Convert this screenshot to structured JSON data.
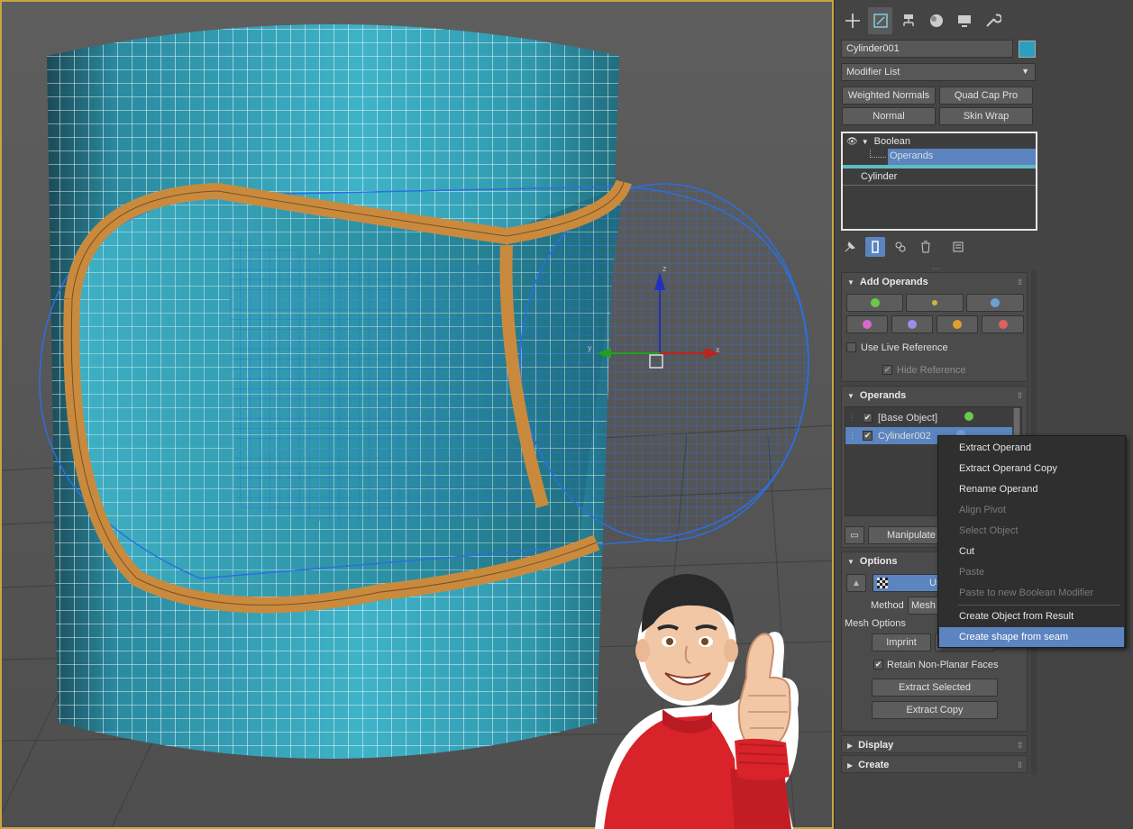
{
  "panel": {
    "tabs": [
      "create-icon",
      "modify-icon",
      "hierarchy-icon",
      "motion-icon",
      "display-icon",
      "utilities-icon"
    ],
    "object_name": "Cylinder001",
    "object_color": "#2a9fc0",
    "modifier_list": "Modifier List",
    "quick_buttons": [
      "Weighted Normals",
      "Quad Cap Pro",
      "Normal",
      "Skin Wrap"
    ],
    "stack": {
      "boolean": "Boolean",
      "operands": "Operands",
      "cylinder": "Cylinder"
    }
  },
  "add_operands": {
    "title": "Add Operands",
    "use_live_reference": "Use Live Reference",
    "hide_reference": "Hide Reference"
  },
  "operands": {
    "title": "Operands",
    "items": [
      "[Base Object]",
      "Cylinder002"
    ],
    "manipulate": "Manipulate"
  },
  "options": {
    "title": "Options",
    "use_label": "Use",
    "method_label": "Method",
    "method_value": "Mesh",
    "mesh_options": "Mesh Options",
    "imprint": "Imprint",
    "retain": "Retain Non-Planar Faces",
    "extract_selected": "Extract Selected",
    "extract_copy": "Extract Copy"
  },
  "display": {
    "title": "Display"
  },
  "create": {
    "title": "Create"
  },
  "context_menu": {
    "items": [
      "Extract Operand",
      "Extract Operand Copy",
      "Rename Operand",
      "Align Pivot",
      "Select Object",
      "Cut",
      "Paste",
      "Paste to new Boolean Modifier",
      "Create Object from Result",
      "Create shape from seam"
    ],
    "disabled": [
      "Align Pivot",
      "Select Object",
      "Paste",
      "Paste to new Boolean Modifier"
    ],
    "highlighted": "Create shape from seam"
  },
  "viewport": {
    "gizmo_axes": [
      "x",
      "y",
      "z"
    ]
  },
  "colors": {
    "accent_selection": "#5b84c0",
    "mesh_teal": "#2f9fb5",
    "seam_orange": "#c98a3e",
    "wire_blue": "#2b6fe0"
  }
}
